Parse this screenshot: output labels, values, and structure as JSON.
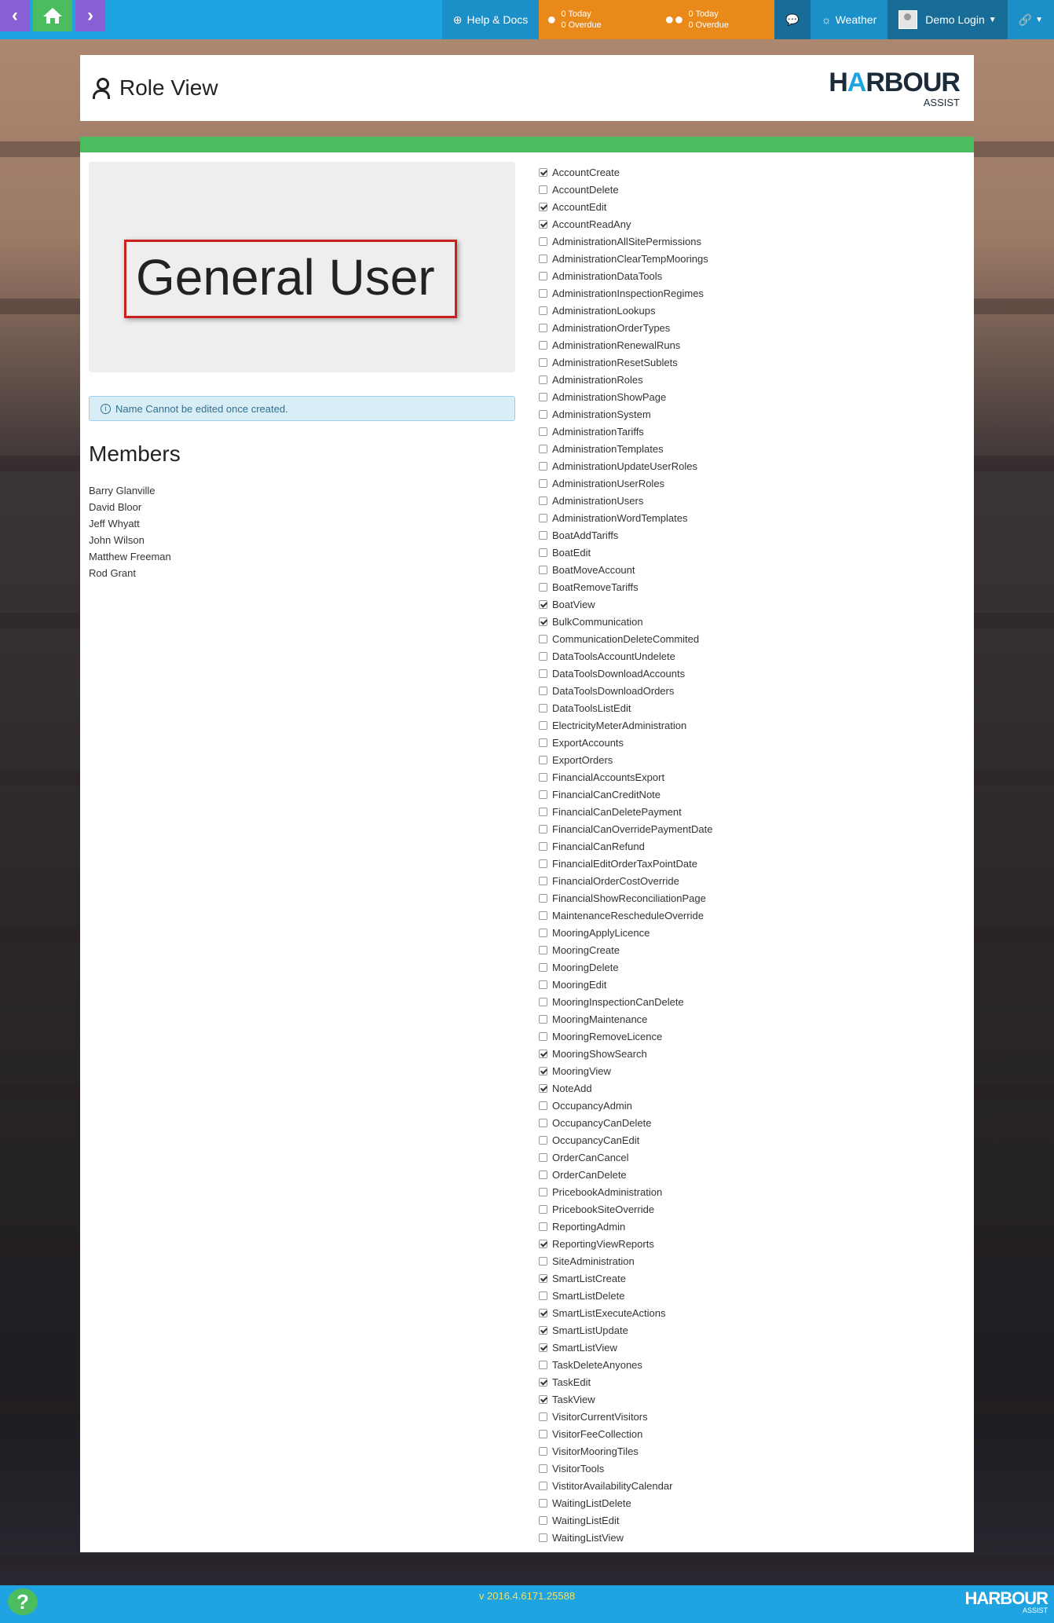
{
  "topbar": {
    "help_label": "Help & Docs",
    "tasks_today": "0 Today",
    "tasks_overdue": "0 Overdue",
    "team_today": "0 Today",
    "team_overdue": "0 Overdue",
    "weather_label": "Weather",
    "login_label": "Demo Login",
    "back_icon": "chevron-left-icon",
    "forward_icon": "chevron-right-icon",
    "home_icon": "home-icon"
  },
  "header": {
    "title": "Role View",
    "logo_word_start": "H",
    "logo_word_a": "A",
    "logo_word_end": "RBOUR",
    "logo_sub": "ASSIST"
  },
  "role": {
    "name": "General User",
    "info": "Name Cannot be edited once created."
  },
  "members": {
    "title": "Members",
    "items": [
      "Barry Glanville",
      "David Bloor",
      "Jeff Whyatt",
      "John Wilson",
      "Matthew Freeman",
      "Rod Grant"
    ]
  },
  "permissions": [
    {
      "label": "AccountCreate",
      "checked": true
    },
    {
      "label": "AccountDelete",
      "checked": false
    },
    {
      "label": "AccountEdit",
      "checked": true
    },
    {
      "label": "AccountReadAny",
      "checked": true
    },
    {
      "label": "AdministrationAllSitePermissions",
      "checked": false
    },
    {
      "label": "AdministrationClearTempMoorings",
      "checked": false
    },
    {
      "label": "AdministrationDataTools",
      "checked": false
    },
    {
      "label": "AdministrationInspectionRegimes",
      "checked": false
    },
    {
      "label": "AdministrationLookups",
      "checked": false
    },
    {
      "label": "AdministrationOrderTypes",
      "checked": false
    },
    {
      "label": "AdministrationRenewalRuns",
      "checked": false
    },
    {
      "label": "AdministrationResetSublets",
      "checked": false
    },
    {
      "label": "AdministrationRoles",
      "checked": false
    },
    {
      "label": "AdministrationShowPage",
      "checked": false
    },
    {
      "label": "AdministrationSystem",
      "checked": false
    },
    {
      "label": "AdministrationTariffs",
      "checked": false
    },
    {
      "label": "AdministrationTemplates",
      "checked": false
    },
    {
      "label": "AdministrationUpdateUserRoles",
      "checked": false
    },
    {
      "label": "AdministrationUserRoles",
      "checked": false
    },
    {
      "label": "AdministrationUsers",
      "checked": false
    },
    {
      "label": "AdministrationWordTemplates",
      "checked": false
    },
    {
      "label": "BoatAddTariffs",
      "checked": false
    },
    {
      "label": "BoatEdit",
      "checked": false
    },
    {
      "label": "BoatMoveAccount",
      "checked": false
    },
    {
      "label": "BoatRemoveTariffs",
      "checked": false
    },
    {
      "label": "BoatView",
      "checked": true
    },
    {
      "label": "BulkCommunication",
      "checked": true
    },
    {
      "label": "CommunicationDeleteCommited",
      "checked": false
    },
    {
      "label": "DataToolsAccountUndelete",
      "checked": false
    },
    {
      "label": "DataToolsDownloadAccounts",
      "checked": false
    },
    {
      "label": "DataToolsDownloadOrders",
      "checked": false
    },
    {
      "label": "DataToolsListEdit",
      "checked": false
    },
    {
      "label": "ElectricityMeterAdministration",
      "checked": false
    },
    {
      "label": "ExportAccounts",
      "checked": false
    },
    {
      "label": "ExportOrders",
      "checked": false
    },
    {
      "label": "FinancialAccountsExport",
      "checked": false
    },
    {
      "label": "FinancialCanCreditNote",
      "checked": false
    },
    {
      "label": "FinancialCanDeletePayment",
      "checked": false
    },
    {
      "label": "FinancialCanOverridePaymentDate",
      "checked": false
    },
    {
      "label": "FinancialCanRefund",
      "checked": false
    },
    {
      "label": "FinancialEditOrderTaxPointDate",
      "checked": false
    },
    {
      "label": "FinancialOrderCostOverride",
      "checked": false
    },
    {
      "label": "FinancialShowReconciliationPage",
      "checked": false
    },
    {
      "label": "MaintenanceRescheduleOverride",
      "checked": false
    },
    {
      "label": "MooringApplyLicence",
      "checked": false
    },
    {
      "label": "MooringCreate",
      "checked": false
    },
    {
      "label": "MooringDelete",
      "checked": false
    },
    {
      "label": "MooringEdit",
      "checked": false
    },
    {
      "label": "MooringInspectionCanDelete",
      "checked": false
    },
    {
      "label": "MooringMaintenance",
      "checked": false
    },
    {
      "label": "MooringRemoveLicence",
      "checked": false
    },
    {
      "label": "MooringShowSearch",
      "checked": true
    },
    {
      "label": "MooringView",
      "checked": true
    },
    {
      "label": "NoteAdd",
      "checked": true
    },
    {
      "label": "OccupancyAdmin",
      "checked": false
    },
    {
      "label": "OccupancyCanDelete",
      "checked": false
    },
    {
      "label": "OccupancyCanEdit",
      "checked": false
    },
    {
      "label": "OrderCanCancel",
      "checked": false
    },
    {
      "label": "OrderCanDelete",
      "checked": false
    },
    {
      "label": "PricebookAdministration",
      "checked": false
    },
    {
      "label": "PricebookSiteOverride",
      "checked": false
    },
    {
      "label": "ReportingAdmin",
      "checked": false
    },
    {
      "label": "ReportingViewReports",
      "checked": true
    },
    {
      "label": "SiteAdministration",
      "checked": false
    },
    {
      "label": "SmartListCreate",
      "checked": true
    },
    {
      "label": "SmartListDelete",
      "checked": false
    },
    {
      "label": "SmartListExecuteActions",
      "checked": true
    },
    {
      "label": "SmartListUpdate",
      "checked": true
    },
    {
      "label": "SmartListView",
      "checked": true
    },
    {
      "label": "TaskDeleteAnyones",
      "checked": false
    },
    {
      "label": "TaskEdit",
      "checked": true
    },
    {
      "label": "TaskView",
      "checked": true
    },
    {
      "label": "VisitorCurrentVisitors",
      "checked": false
    },
    {
      "label": "VisitorFeeCollection",
      "checked": false
    },
    {
      "label": "VisitorMooringTiles",
      "checked": false
    },
    {
      "label": "VisitorTools",
      "checked": false
    },
    {
      "label": "VistitorAvailabilityCalendar",
      "checked": false
    },
    {
      "label": "WaitingListDelete",
      "checked": false
    },
    {
      "label": "WaitingListEdit",
      "checked": false
    },
    {
      "label": "WaitingListView",
      "checked": false
    }
  ],
  "footer": {
    "version": "v 2016.4.6171.25588",
    "help": "?",
    "logo_word": "HARBOUR",
    "logo_sub": "ASSIST"
  },
  "colors": {
    "topbar": "#1fa3e1",
    "accent_green": "#4cbd5f",
    "accent_purple": "#8a5fd4",
    "accent_orange": "#e8891a",
    "highlight_red": "#cc2020"
  }
}
